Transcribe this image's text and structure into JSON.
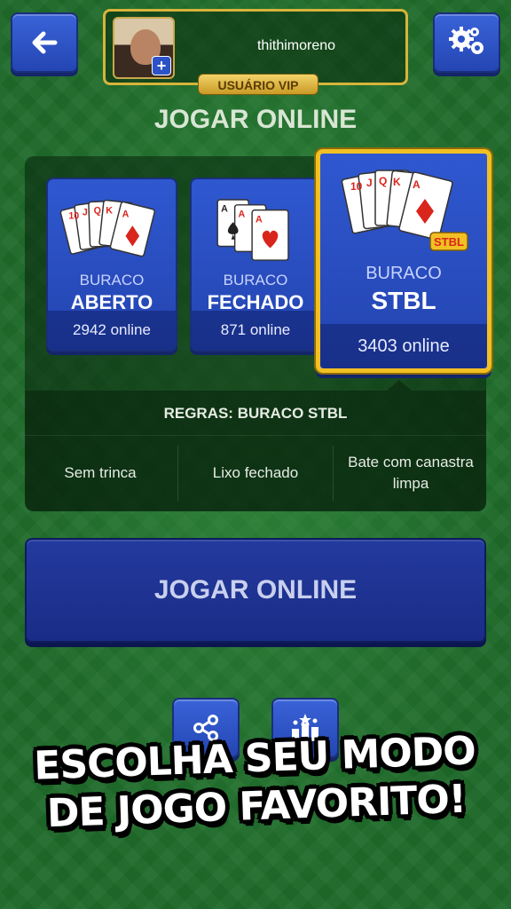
{
  "header": {
    "username": "thithimoreno",
    "vip_badge": "USUÁRIO VIP",
    "avatar_plus": "+"
  },
  "page_title": "JOGAR ONLINE",
  "modes": [
    {
      "line1": "BURACO",
      "line2": "ABERTO",
      "online": "2942 online"
    },
    {
      "line1": "BURACO",
      "line2": "FECHADO",
      "online": "871 online"
    },
    {
      "line1": "BURACO",
      "line2": "STBL",
      "online": "3403 online",
      "card_badge": "STBL",
      "selected": true
    }
  ],
  "rules": {
    "title": "REGRAS: BURACO STBL",
    "items": [
      "Sem trinca",
      "Lixo fechado",
      "Bate com canastra limpa"
    ]
  },
  "play_button": "JOGAR ONLINE",
  "banner": {
    "line1": "ESCOLHA SEU MODO",
    "line2": "DE JOGO FAVORITO!"
  },
  "colors": {
    "felt": "#1f6b2a",
    "button_blue": "#2c52c6",
    "gold": "#f2c023"
  },
  "icons": {
    "back": "arrow-left-icon",
    "settings": "gears-icon",
    "share": "share-icon",
    "ranking": "ranking-icon"
  }
}
